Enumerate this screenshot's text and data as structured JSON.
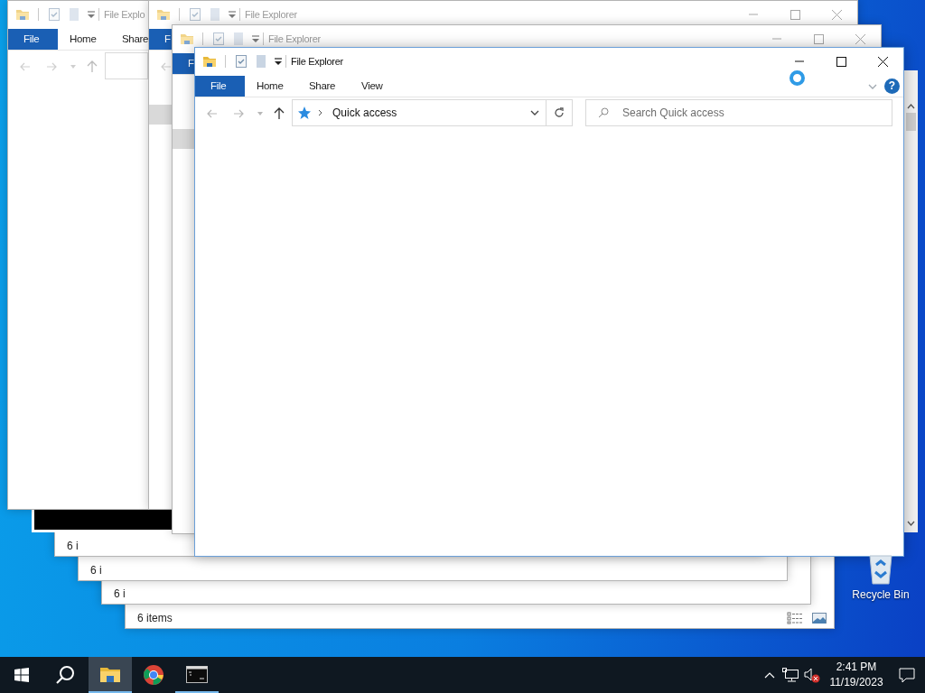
{
  "background_windows": [
    {
      "kind": "explorer",
      "status": "6 items"
    },
    {
      "kind": "explorer",
      "status": "6 i"
    },
    {
      "kind": "explorer",
      "status": "6 i"
    },
    {
      "kind": "explorer",
      "status": "6 i"
    },
    {
      "kind": "terminal"
    },
    {
      "kind": "explorer",
      "title": "File Explo",
      "tabs": [
        {
          "label": "File",
          "selected": true
        },
        {
          "label": "Home",
          "selected": false
        },
        {
          "label": "Share",
          "selected": false
        }
      ]
    },
    {
      "kind": "explorer",
      "title": "File Explorer",
      "tabs": [
        {
          "label": "F",
          "selected": true
        }
      ]
    },
    {
      "kind": "explorer",
      "title": "File Explorer",
      "tabs": [
        {
          "label": "F",
          "selected": true
        }
      ]
    }
  ],
  "window": {
    "title": "File Explorer",
    "tabs": [
      {
        "label": "File",
        "selected": true
      },
      {
        "label": "Home",
        "selected": false
      },
      {
        "label": "Share",
        "selected": false
      },
      {
        "label": "View",
        "selected": false
      }
    ],
    "help": "?",
    "address": {
      "path": "Quick access"
    },
    "search": {
      "placeholder": "Search Quick access"
    }
  },
  "desktop_icons": [
    {
      "label": "Recycle Bin"
    }
  ],
  "taskbar": {
    "apps": [
      {
        "kind": "explorer",
        "selected": true,
        "running": true
      },
      {
        "kind": "chrome",
        "selected": false,
        "running": false
      },
      {
        "kind": "terminal",
        "selected": false,
        "running": true
      }
    ],
    "clock": {
      "time": "2:41 PM",
      "date": "11/19/2023"
    }
  }
}
